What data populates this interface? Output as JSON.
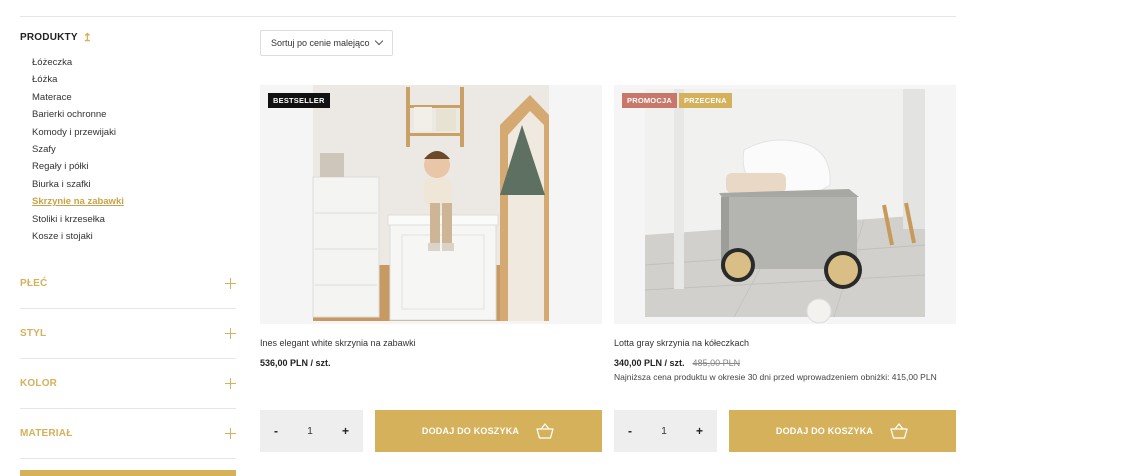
{
  "sidebar": {
    "category_title": "PRODUKTY",
    "categories": [
      {
        "label": "Łóżeczka"
      },
      {
        "label": "Łóżka"
      },
      {
        "label": "Materace"
      },
      {
        "label": "Barierki ochronne"
      },
      {
        "label": "Komody i przewijaki"
      },
      {
        "label": "Szafy"
      },
      {
        "label": "Regały i półki"
      },
      {
        "label": "Biurka i szafki"
      },
      {
        "label": "Skrzynie na zabawki",
        "active": true
      },
      {
        "label": "Stoliki i krzesełka"
      },
      {
        "label": "Kosze i stojaki"
      }
    ],
    "filters": [
      {
        "label": "PŁEĆ"
      },
      {
        "label": "STYL"
      },
      {
        "label": "KOLOR"
      },
      {
        "label": "MATERIAŁ"
      }
    ]
  },
  "sort": {
    "label": "Sortuj po cenie malejąco"
  },
  "products": [
    {
      "name": "Ines elegant white skrzynia na zabawki",
      "price": "536,00 PLN / szt.",
      "badges": [
        {
          "label": "BESTSELLER",
          "color": "#111111"
        }
      ],
      "quantity": "1",
      "add_label": "DODAJ DO KOSZYKA"
    },
    {
      "name": "Lotta gray skrzynia na kółeczkach",
      "price": "340,00 PLN / szt.",
      "old_price": "485,00 PLN",
      "lowest_price_note": "Najniższa cena produktu w okresie 30 dni przed wprowadzeniem obniżki: 415,00 PLN",
      "badges": [
        {
          "label": "PROMOCJA",
          "color": "#c8776b"
        },
        {
          "label": "PRZECENA",
          "color": "#d4b15a"
        }
      ],
      "quantity": "1",
      "add_label": "DODAJ DO KOSZYKA"
    }
  ],
  "colors": {
    "accent": "#d4b15a",
    "badge_bestseller": "#111111",
    "badge_promo": "#c8776b"
  }
}
